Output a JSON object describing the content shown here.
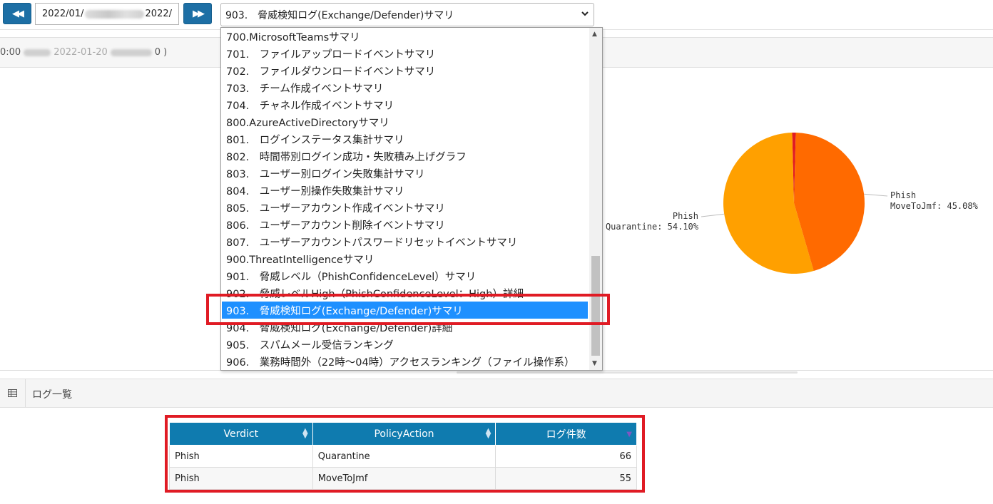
{
  "toolbar": {
    "prev_icon": "double-left-arrow-icon",
    "next_icon": "double-right-arrow-icon",
    "date_start": "2022/01/",
    "date_end": "2022/",
    "selected_report": "903.　脅威検知ログ(Exchange/Defender)サマリ",
    "select_icon": "chevron-down-icon"
  },
  "period": {
    "text_start": "0:00",
    "text_mid": "2022-01-20",
    "text_end": "0 )"
  },
  "dropdown": {
    "items": [
      "700.MicrosoftTeamsサマリ",
      "701.　ファイルアップロードイベントサマリ",
      "702.　ファイルダウンロードイベントサマリ",
      "703.　チーム作成イベントサマリ",
      "704.　チャネル作成イベントサマリ",
      "800.AzureActiveDirectoryサマリ",
      "801.　ログインステータス集計サマリ",
      "802.　時間帯別ログイン成功・失敗積み上げグラフ",
      "803.　ユーザー別ログイン失敗集計サマリ",
      "804.　ユーザー別操作失敗集計サマリ",
      "805.　ユーザーアカウント作成イベントサマリ",
      "806.　ユーザーアカウント削除イベントサマリ",
      "807.　ユーザーアカウントパスワードリセットイベントサマリ",
      "900.ThreatIntelligenceサマリ",
      "901.　脅威レベル（PhishConfidenceLevel）サマリ",
      "902.　脅威レベルHigh（PhishConfidenceLevel：High）詳細",
      "903.　脅威検知ログ(Exchange/Defender)サマリ",
      "904.　脅威検知ログ(Exchange/Defender)詳細",
      "905.　スパムメール受信ランキング",
      "906.　業務時間外（22時〜04時）アクセスランキング（ファイル操作系）"
    ],
    "selected_index": 16,
    "scroll_up_icon": "scroll-up-arrow-icon",
    "scroll_down_icon": "scroll-down-arrow-icon"
  },
  "chart_data": {
    "type": "pie",
    "slices": [
      {
        "label_line1": "Phish",
        "label_line2": "MoveToJmf: 45.08%",
        "value": 45.08,
        "color": "#ff6a00"
      },
      {
        "label_line1": "Phish",
        "label_line2": "Quarantine: 54.10%",
        "value": 54.1,
        "color": "#ffa000"
      },
      {
        "label_line1": "",
        "label_line2": "",
        "value": 0.82,
        "color": "#e01b24"
      }
    ]
  },
  "log_list": {
    "icon": "table-grid-icon",
    "title": "ログ一覧",
    "columns": [
      "Verdict",
      "PolicyAction",
      "ログ件数"
    ],
    "rows": [
      {
        "verdict": "Phish",
        "policy_action": "Quarantine",
        "count": "66"
      },
      {
        "verdict": "Phish",
        "policy_action": "MoveToJmf",
        "count": "55"
      }
    ]
  },
  "colors": {
    "header_blue": "#0f7baf",
    "nav_button_blue": "#1d6fa5",
    "highlight_red": "#e01b24",
    "selected_item_blue": "#1e90ff"
  }
}
